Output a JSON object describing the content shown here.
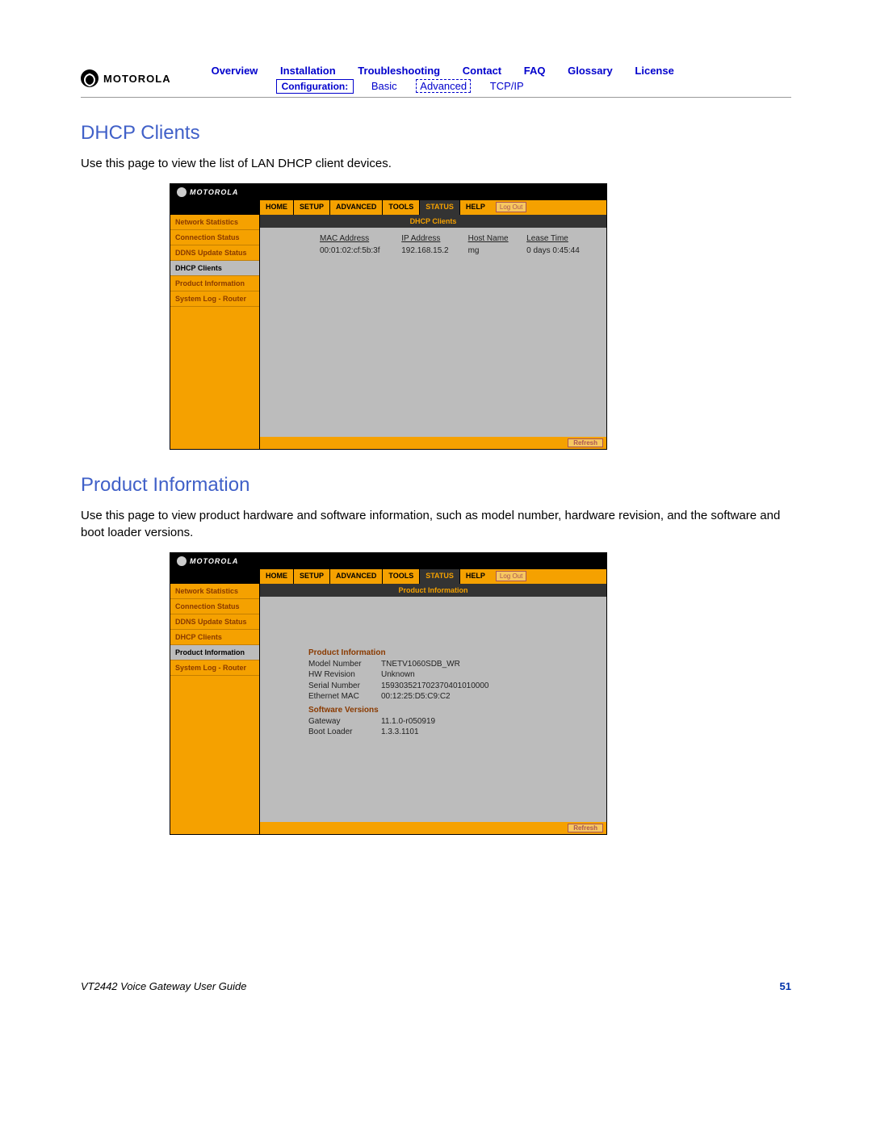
{
  "doc_header": {
    "brand": "MOTOROLA",
    "nav1": {
      "overview": "Overview",
      "installation": "Installation",
      "troubleshooting": "Troubleshooting",
      "contact": "Contact",
      "faq": "FAQ",
      "glossary": "Glossary",
      "license": "License"
    },
    "nav2": {
      "configuration_label": "Configuration:",
      "basic": "Basic",
      "advanced": "Advanced",
      "tcpip": "TCP/IP"
    }
  },
  "section1": {
    "title": "DHCP Clients",
    "desc": "Use this page to view the list of LAN DHCP client devices."
  },
  "router_common": {
    "brand": "MOTOROLA",
    "tabs": {
      "home": "HOME",
      "setup": "SETUP",
      "advanced": "ADVANCED",
      "tools": "TOOLS",
      "status": "STATUS",
      "help": "HELP"
    },
    "logout": "Log Out",
    "refresh": "Refresh",
    "sidebar": {
      "network_statistics": "Network Statistics",
      "connection_status": "Connection Status",
      "ddns_update_status": "DDNS Update Status",
      "dhcp_clients": "DHCP Clients",
      "product_information": "Product Information",
      "system_log_router": "System Log - Router"
    }
  },
  "router1": {
    "titlebar": "DHCP Clients",
    "headers": {
      "mac": "MAC Address",
      "ip": "IP Address",
      "host": "Host Name",
      "lease": "Lease Time"
    },
    "rows": [
      {
        "mac": "00:01:02:cf:5b:3f",
        "ip": "192.168.15.2",
        "host": "mg",
        "lease": "0 days 0:45:44"
      }
    ]
  },
  "section2": {
    "title": "Product Information",
    "desc": "Use this page to view product hardware and software information, such as model number, hardware revision, and the software and boot loader versions."
  },
  "router2": {
    "titlebar": "Product Information",
    "pi_heading": "Product Information",
    "pi_rows": {
      "model_number_k": "Model Number",
      "model_number_v": "TNETV1060SDB_WR",
      "hw_rev_k": "HW Revision",
      "hw_rev_v": "Unknown",
      "serial_k": "Serial Number",
      "serial_v": "159303521702370401010000",
      "eth_mac_k": "Ethernet MAC",
      "eth_mac_v": "00:12:25:D5:C9:C2"
    },
    "sv_heading": "Software Versions",
    "sv_rows": {
      "gateway_k": "Gateway",
      "gateway_v": "11.1.0-r050919",
      "boot_k": "Boot Loader",
      "boot_v": "1.3.3.1101"
    }
  },
  "footer": {
    "guide": "VT2442 Voice Gateway User Guide",
    "page": "51"
  }
}
